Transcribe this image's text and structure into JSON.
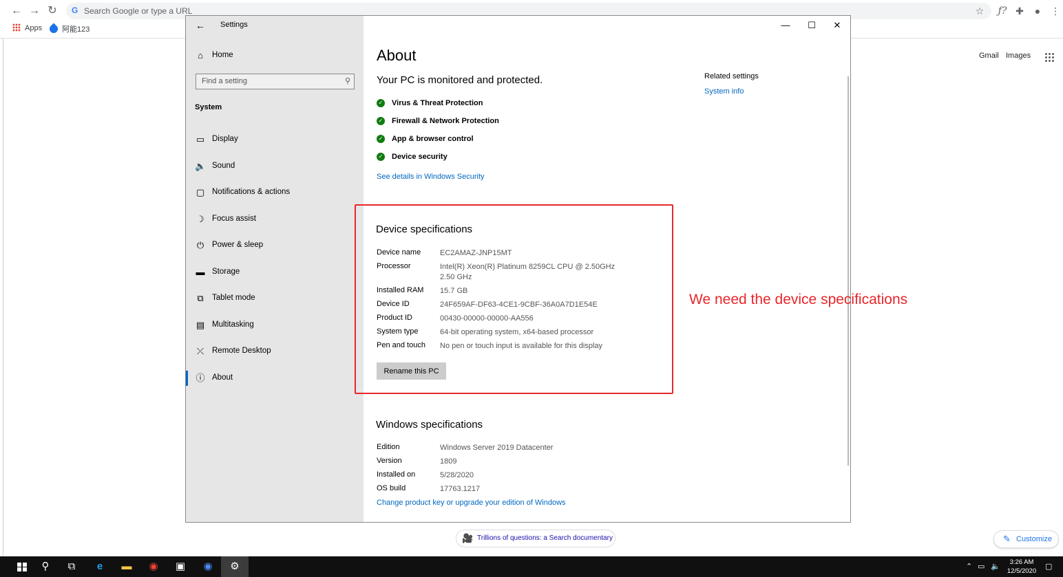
{
  "browser": {
    "omnibox_placeholder": "Search Google or type a URL",
    "bookmarks": [
      {
        "label": "Apps"
      },
      {
        "label": "阿能123"
      }
    ]
  },
  "google": {
    "gmail_label": "Gmail",
    "images_label": "Images",
    "doodle_chip_label": "Trillions of questions: a Search documentary",
    "customize_label": "Customize"
  },
  "settings": {
    "window_title": "Settings",
    "home_label": "Home",
    "search_placeholder": "Find a setting",
    "section_label": "System",
    "nav_items": [
      {
        "label": "Display",
        "icon": "monitor-icon"
      },
      {
        "label": "Sound",
        "icon": "speaker-icon"
      },
      {
        "label": "Notifications & actions",
        "icon": "notification-icon"
      },
      {
        "label": "Focus assist",
        "icon": "moon-icon"
      },
      {
        "label": "Power & sleep",
        "icon": "power-icon"
      },
      {
        "label": "Storage",
        "icon": "storage-icon"
      },
      {
        "label": "Tablet mode",
        "icon": "tablet-icon"
      },
      {
        "label": "Multitasking",
        "icon": "multitasking-icon"
      },
      {
        "label": "Remote Desktop",
        "icon": "remote-desktop-icon"
      },
      {
        "label": "About",
        "icon": "info-icon",
        "active": true
      }
    ],
    "about": {
      "title": "About",
      "protection_heading": "Your PC is monitored and protected.",
      "protections": [
        "Virus & Threat Protection",
        "Firewall & Network Protection",
        "App & browser control",
        "Device security"
      ],
      "security_link": "See details in Windows Security",
      "related_heading": "Related settings",
      "related_link": "System info",
      "device_specs_title": "Device specifications",
      "device_specs": [
        {
          "key": "Device name",
          "value": "EC2AMAZ-JNP15MT"
        },
        {
          "key": "Processor",
          "value": "Intel(R) Xeon(R) Platinum 8259CL CPU @ 2.50GHz 2.50 GHz"
        },
        {
          "key": "Installed RAM",
          "value": "15.7 GB"
        },
        {
          "key": "Device ID",
          "value": "24F659AF-DF63-4CE1-9CBF-36A0A7D1E54E"
        },
        {
          "key": "Product ID",
          "value": "00430-00000-00000-AA556"
        },
        {
          "key": "System type",
          "value": "64-bit operating system, x64-based processor"
        },
        {
          "key": "Pen and touch",
          "value": "No pen or touch input is available for this display"
        }
      ],
      "rename_button": "Rename this PC",
      "windows_specs_title": "Windows specifications",
      "windows_specs": [
        {
          "key": "Edition",
          "value": "Windows Server 2019 Datacenter"
        },
        {
          "key": "Version",
          "value": "1809"
        },
        {
          "key": "Installed on",
          "value": "5/28/2020"
        },
        {
          "key": "OS build",
          "value": "17763.1217"
        }
      ],
      "product_key_link": "Change product key or upgrade your edition of Windows"
    }
  },
  "annotation": {
    "text": "We need the device specifications",
    "color": "#e8262a"
  },
  "taskbar": {
    "time": "3:26 AM",
    "date": "12/5/2020"
  },
  "colors": {
    "accent": "#0067c0",
    "check_green": "#107c10",
    "sidebar_bg": "#e6e6e6"
  }
}
